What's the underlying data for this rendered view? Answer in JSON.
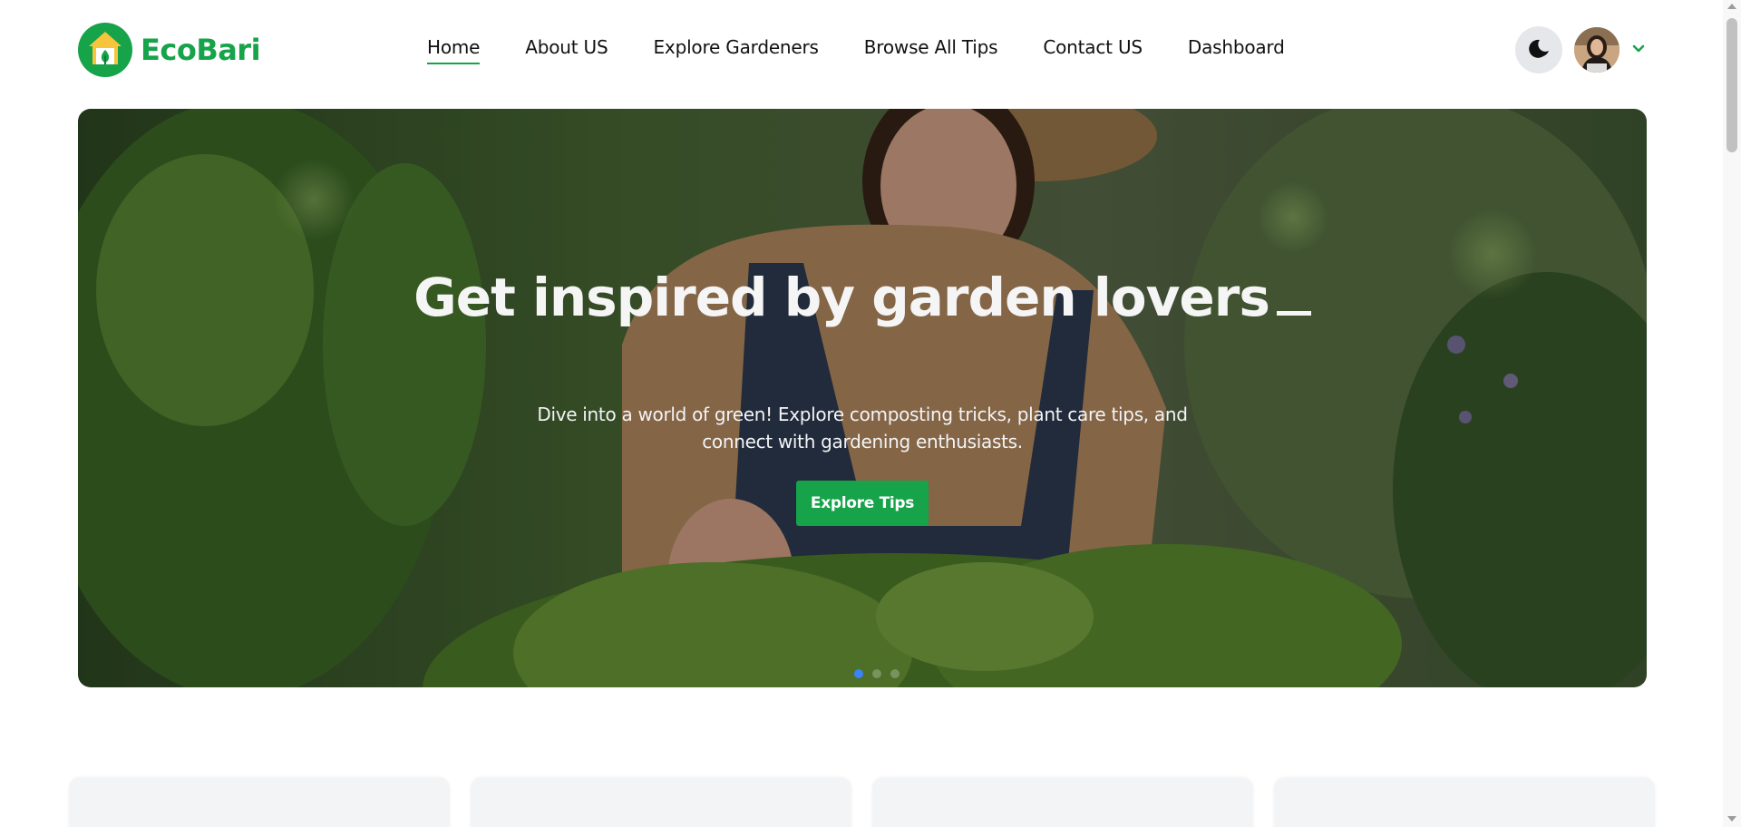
{
  "brand": {
    "name": "EcoBari"
  },
  "nav": {
    "items": [
      {
        "label": "Home",
        "active": true
      },
      {
        "label": "About US"
      },
      {
        "label": "Explore Gardeners"
      },
      {
        "label": "Browse All Tips"
      },
      {
        "label": "Contact US"
      },
      {
        "label": "Dashboard"
      }
    ]
  },
  "header": {
    "theme_toggle_icon": "moon-icon",
    "avatar_icon": "user-avatar",
    "menu_icon": "chevron-down-icon"
  },
  "hero": {
    "title": "Get inspired by garden lovers",
    "subtitle": "Dive into a world of green! Explore composting tricks, plant care tips, and connect with gardening enthusiasts.",
    "cta_label": "Explore Tips",
    "slides": 3,
    "active_slide": 1
  },
  "colors": {
    "brand": "#16a34a",
    "active_dot": "#3b82f6",
    "toggle_bg": "#e5e7eb"
  }
}
